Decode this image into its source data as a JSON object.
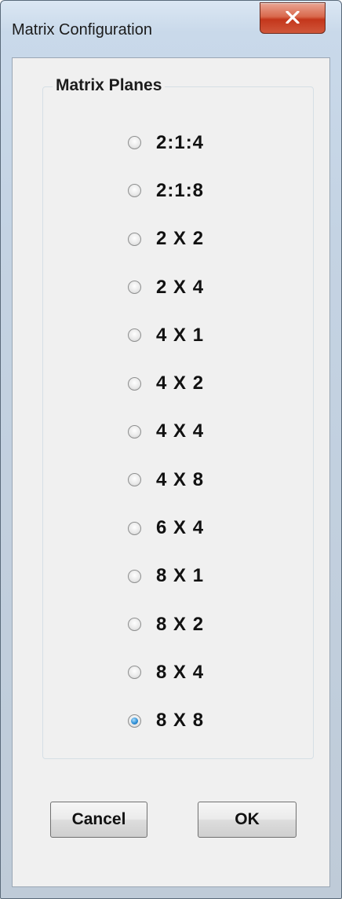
{
  "window": {
    "title": "Matrix Configuration",
    "close_icon": "close-x-icon"
  },
  "group": {
    "title": "Matrix Planes",
    "options": [
      {
        "label": "2:1:4",
        "checked": false
      },
      {
        "label": "2:1:8",
        "checked": false
      },
      {
        "label": "2 X 2",
        "checked": false
      },
      {
        "label": "2 X 4",
        "checked": false
      },
      {
        "label": "4 X 1",
        "checked": false
      },
      {
        "label": "4 X 2",
        "checked": false
      },
      {
        "label": "4 X 4",
        "checked": false
      },
      {
        "label": "4 X 8",
        "checked": false
      },
      {
        "label": "6 X 4",
        "checked": false
      },
      {
        "label": "8 X 1",
        "checked": false
      },
      {
        "label": "8 X 2",
        "checked": false
      },
      {
        "label": "8 X 4",
        "checked": false
      },
      {
        "label": "8 X 8",
        "checked": true
      }
    ]
  },
  "buttons": {
    "cancel_label": "Cancel",
    "ok_label": "OK"
  },
  "colors": {
    "close_button": "#c4361b",
    "radio_selected": "#2f8fd6",
    "dialog_background": "#f0f0f0"
  }
}
